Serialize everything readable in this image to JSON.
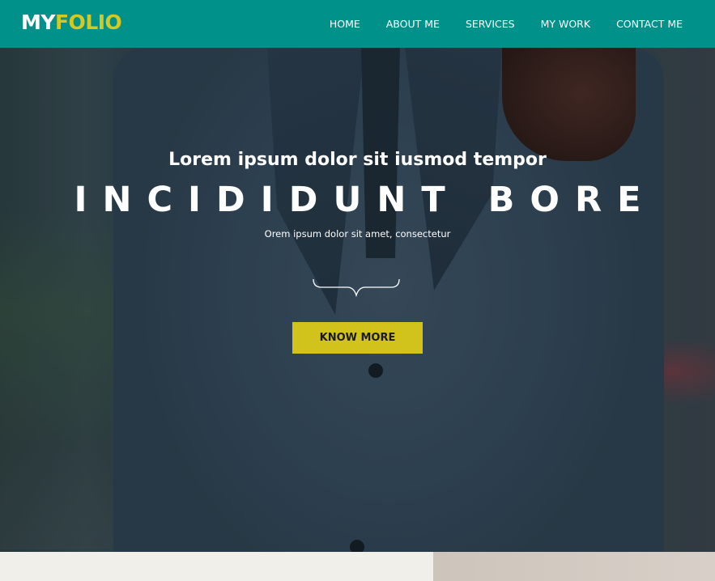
{
  "brand": {
    "logo_part1": "MY",
    "logo_part2": "FOLIO",
    "primary_color": "#00918a",
    "accent_color": "#d1c31c"
  },
  "nav": {
    "items": [
      {
        "label": "HOME"
      },
      {
        "label": "ABOUT ME"
      },
      {
        "label": "SERVICES"
      },
      {
        "label": "MY WORK"
      },
      {
        "label": "CONTACT ME"
      }
    ]
  },
  "hero": {
    "subtitle": "Lorem ipsum dolor sit iusmod tempor",
    "title": "INCIDIDUNT BORE",
    "tagline": "Orem ipsum dolor sit amet, consectetur",
    "divider_icon": "curly-brace-icon",
    "cta_label": "KNOW MORE"
  }
}
